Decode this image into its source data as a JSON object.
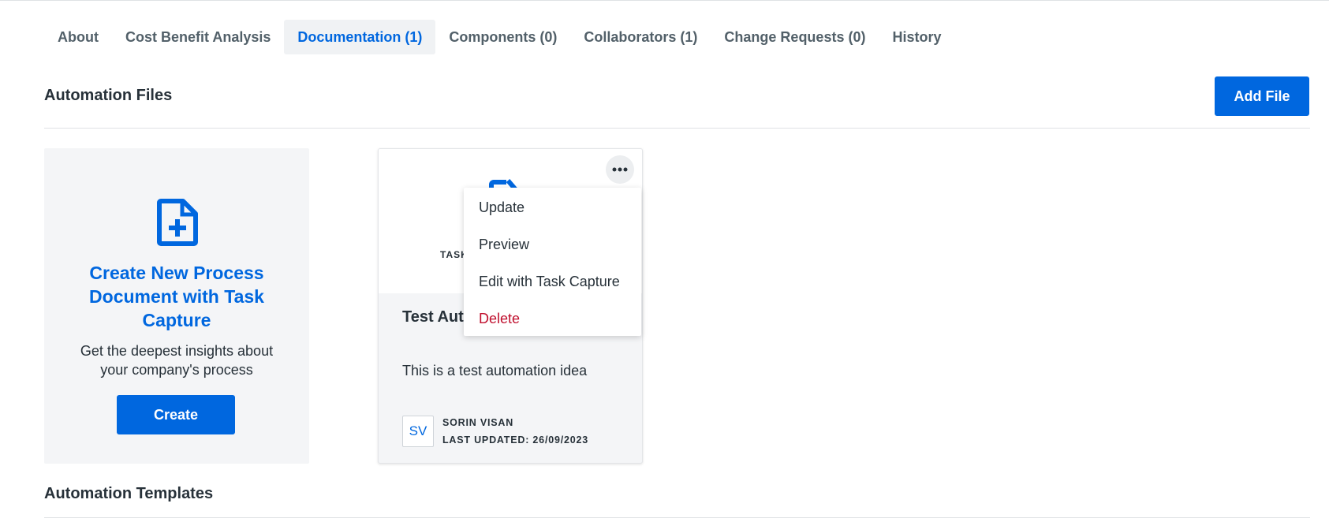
{
  "tabs": [
    {
      "label": "About"
    },
    {
      "label": "Cost Benefit Analysis"
    },
    {
      "label": "Documentation (1)"
    },
    {
      "label": "Components (0)"
    },
    {
      "label": "Collaborators (1)"
    },
    {
      "label": "Change Requests (0)"
    },
    {
      "label": "History"
    }
  ],
  "active_tab": "Documentation (1)",
  "automation_files": {
    "title": "Automation Files",
    "add_button": "Add File"
  },
  "create_card": {
    "icon": "file-plus-icon",
    "title": "Create New Process Document with Task Capture",
    "description": "Get the deepest insights about your company's process",
    "button": "Create"
  },
  "file_card": {
    "thumbnail_label": "TASK",
    "title": "Test Aut",
    "description": "This is a test automation idea",
    "avatar_initials": "SV",
    "author": "SORIN VISAN",
    "last_updated": "LAST UPDATED: 26/09/2023",
    "more_icon": "more-horizontal-icon"
  },
  "context_menu": {
    "items": [
      {
        "label": "Update"
      },
      {
        "label": "Preview"
      },
      {
        "label": "Edit with Task Capture"
      },
      {
        "label": "Delete"
      }
    ]
  },
  "automation_templates": {
    "title": "Automation Templates"
  },
  "colors": {
    "accent": "#0067df",
    "danger": "#c00f2d",
    "text": "#273139",
    "muted": "#526069",
    "card_bg": "#f4f5f7"
  }
}
